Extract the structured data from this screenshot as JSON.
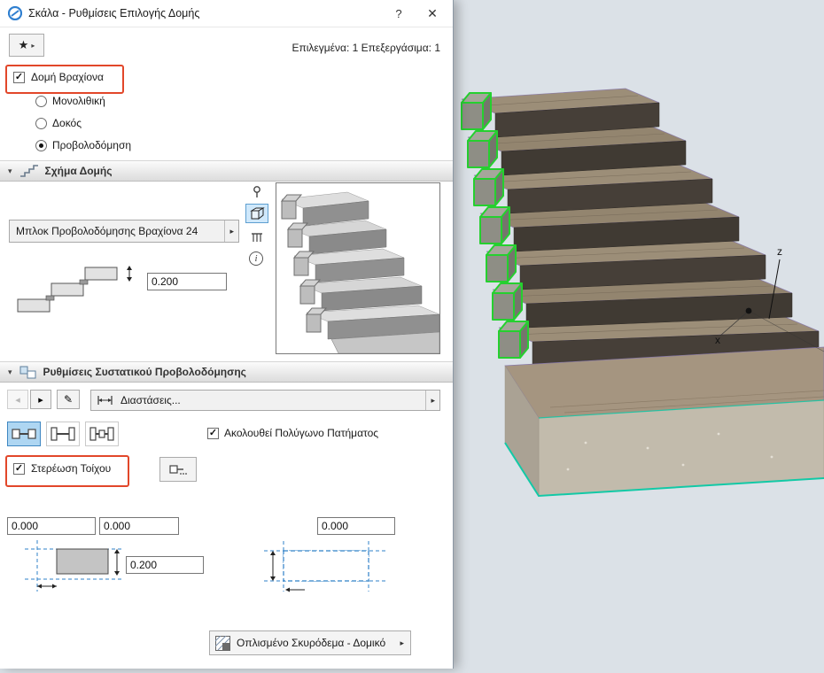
{
  "window": {
    "title": "Σκάλα - Ρυθμίσεις Επιλογής Δομής",
    "help": "?",
    "close": "✕"
  },
  "header": {
    "selection_info": "Επιλεγμένα: 1 Επεξεργάσιμα: 1"
  },
  "icons": {
    "check": "✓",
    "star": "★",
    "arrow_right": "▸",
    "arrow_left": "◂",
    "arrow_down": "▾",
    "edit": "✎",
    "info": "i"
  },
  "structure": {
    "beam_structure_label": "Δομή Βραχίονα",
    "options": [
      {
        "label": "Μονολιθική",
        "selected": false
      },
      {
        "label": "Δοκός",
        "selected": false
      },
      {
        "label": "Προβολοδόμηση",
        "selected": true
      }
    ]
  },
  "shape_section": {
    "title": "Σχήμα Δομής",
    "block_dropdown": "Μπλοκ Προβολοδόμησης Βραχίονα 24",
    "height_value": "0.200"
  },
  "component_section": {
    "title": "Ρυθμίσεις Συστατικού Προβολοδόμησης",
    "dimensions_dropdown": "Διαστάσεις...",
    "follow_polygon_label": "Ακολουθεί Πολύγωνο Πατήματος",
    "wall_fixing_label": "Στερέωση Τοίχου"
  },
  "dimensions": {
    "offset_left": "0.000",
    "offset_right": "0.000",
    "offset_far": "0.000",
    "thickness": "0.200"
  },
  "material": {
    "label": "Οπλισμένο Σκυρόδεμα - Δομικό"
  },
  "viewport": {
    "axis_z": "z",
    "axis_x": "x"
  },
  "colors": {
    "highlight_red": "#e2472a",
    "selection_green": "#25d02f",
    "base_teal": "#12c9a6",
    "selected_blue": "#aed6f2",
    "viewport_bg": "#dbe1e7"
  }
}
